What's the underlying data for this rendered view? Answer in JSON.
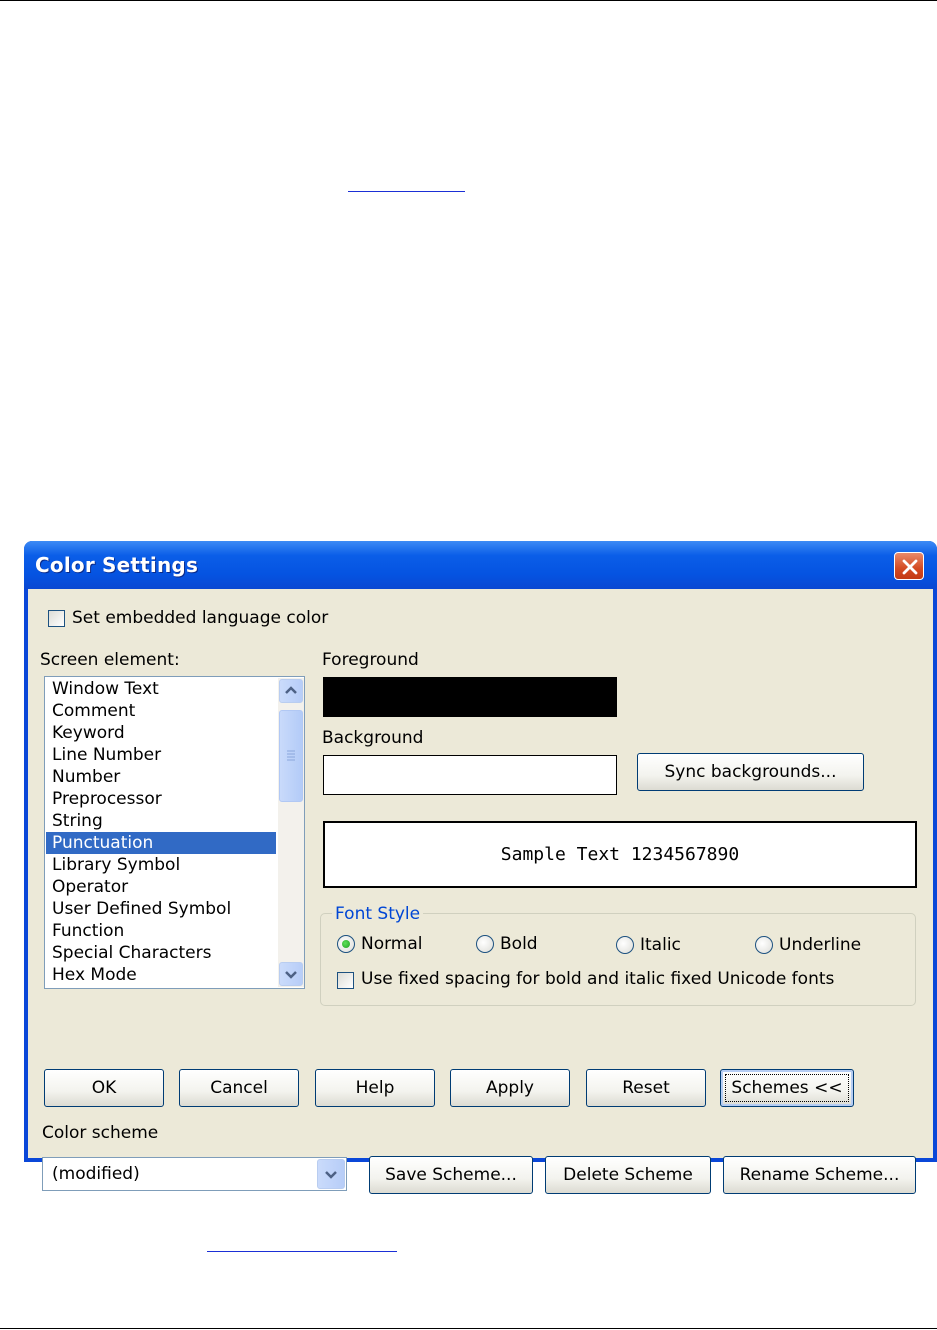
{
  "dialog": {
    "title": "Color Settings",
    "embedded_checkbox": {
      "label": "Set embedded language color",
      "checked": false
    },
    "screen_element": {
      "label": "Screen element:",
      "items": [
        "Window Text",
        "Comment",
        "Keyword",
        "Line Number",
        "Number",
        "Preprocessor",
        "String",
        "Punctuation",
        "Library Symbol",
        "Operator",
        "User Defined Symbol",
        "Function",
        "Special Characters",
        "Hex Mode"
      ],
      "selected": "Punctuation"
    },
    "foreground": {
      "label": "Foreground",
      "color": "#000000"
    },
    "background": {
      "label": "Background",
      "color": "#ffffff"
    },
    "sync_button": "Sync backgrounds...",
    "sample_text": "Sample Text 1234567890",
    "font_style": {
      "title": "Font Style",
      "options": [
        "Normal",
        "Bold",
        "Italic",
        "Underline"
      ],
      "selected": "Normal",
      "fixed_spacing_label": "Use fixed spacing for bold and italic fixed Unicode fonts",
      "fixed_spacing_checked": false
    },
    "buttons": {
      "ok": "OK",
      "cancel": "Cancel",
      "help": "Help",
      "apply": "Apply",
      "reset": "Reset",
      "schemes": "Schemes <<"
    },
    "color_scheme": {
      "label": "Color scheme",
      "value": "(modified)",
      "save": "Save Scheme...",
      "delete": "Delete Scheme",
      "rename": "Rename Scheme..."
    }
  },
  "colors": {
    "selection": "#316ac5",
    "title_blue": "#0a47d8",
    "group_title": "#0046d5",
    "link": "#1b2fd6"
  }
}
